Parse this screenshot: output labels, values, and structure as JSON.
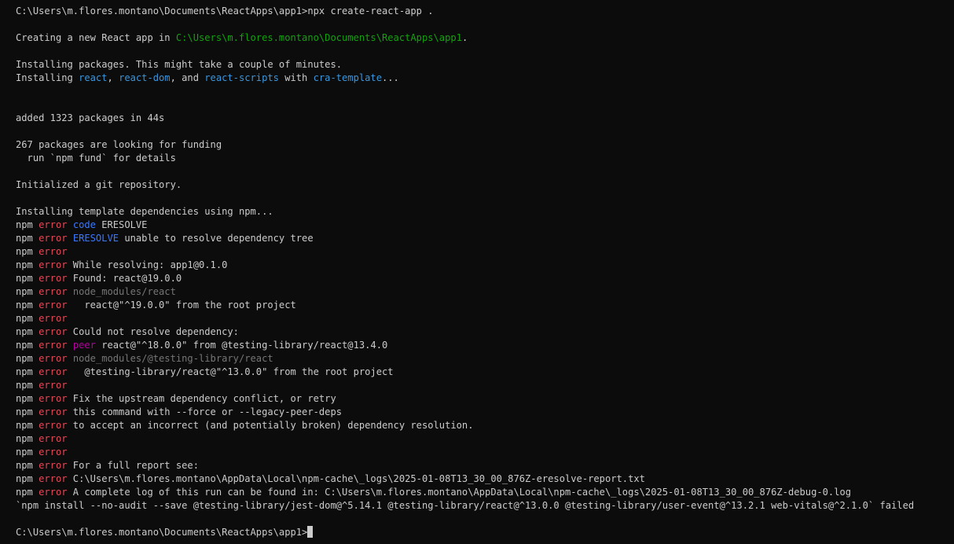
{
  "colors": {
    "background": "#0c0c0c",
    "text": "#cccccc",
    "path_green": "#13a10e",
    "package_cyan": "#3a96dd",
    "error_red": "#e74856",
    "code_blue": "#3b78ff",
    "dim_gray": "#767676",
    "peer_magenta": "#b4009e"
  },
  "lines": [
    [
      {
        "t": "C:\\Users\\m.flores.montano\\Documents\\ReactApps\\app1>npx create-react-app ."
      }
    ],
    [],
    [
      {
        "t": "Creating a new React app in "
      },
      {
        "t": "C:\\Users\\m.flores.montano\\Documents\\ReactApps\\app1",
        "c": "path_green"
      },
      {
        "t": "."
      }
    ],
    [],
    [
      {
        "t": "Installing packages. This might take a couple of minutes."
      }
    ],
    [
      {
        "t": "Installing "
      },
      {
        "t": "react",
        "c": "package_cyan"
      },
      {
        "t": ", "
      },
      {
        "t": "react-dom",
        "c": "package_cyan"
      },
      {
        "t": ", and "
      },
      {
        "t": "react-scripts",
        "c": "package_cyan"
      },
      {
        "t": " with "
      },
      {
        "t": "cra-template",
        "c": "package_cyan"
      },
      {
        "t": "..."
      }
    ],
    [],
    [],
    [
      {
        "t": "added 1323 packages in 44s"
      }
    ],
    [],
    [
      {
        "t": "267 packages are looking for funding"
      }
    ],
    [
      {
        "t": "  run `npm fund` for details"
      }
    ],
    [],
    [
      {
        "t": "Initialized a git repository."
      }
    ],
    [],
    [
      {
        "t": "Installing template dependencies using npm..."
      }
    ],
    [
      {
        "t": "npm "
      },
      {
        "t": "error",
        "c": "error_red"
      },
      {
        "t": " "
      },
      {
        "t": "code",
        "c": "code_blue"
      },
      {
        "t": " ERESOLVE"
      }
    ],
    [
      {
        "t": "npm "
      },
      {
        "t": "error",
        "c": "error_red"
      },
      {
        "t": " "
      },
      {
        "t": "ERESOLVE",
        "c": "code_blue"
      },
      {
        "t": " unable to resolve dependency tree"
      }
    ],
    [
      {
        "t": "npm "
      },
      {
        "t": "error",
        "c": "error_red"
      }
    ],
    [
      {
        "t": "npm "
      },
      {
        "t": "error",
        "c": "error_red"
      },
      {
        "t": " While resolving: app1@0.1.0"
      }
    ],
    [
      {
        "t": "npm "
      },
      {
        "t": "error",
        "c": "error_red"
      },
      {
        "t": " Found: react@19.0.0"
      }
    ],
    [
      {
        "t": "npm "
      },
      {
        "t": "error",
        "c": "error_red"
      },
      {
        "t": " "
      },
      {
        "t": "node_modules/react",
        "c": "dim_gray"
      }
    ],
    [
      {
        "t": "npm "
      },
      {
        "t": "error",
        "c": "error_red"
      },
      {
        "t": "   react@\"^19.0.0\" from the root project"
      }
    ],
    [
      {
        "t": "npm "
      },
      {
        "t": "error",
        "c": "error_red"
      }
    ],
    [
      {
        "t": "npm "
      },
      {
        "t": "error",
        "c": "error_red"
      },
      {
        "t": " Could not resolve dependency:"
      }
    ],
    [
      {
        "t": "npm "
      },
      {
        "t": "error",
        "c": "error_red"
      },
      {
        "t": " "
      },
      {
        "t": "peer",
        "c": "peer_magenta"
      },
      {
        "t": " react@\"^18.0.0\" from @testing-library/react@13.4.0"
      }
    ],
    [
      {
        "t": "npm "
      },
      {
        "t": "error",
        "c": "error_red"
      },
      {
        "t": " "
      },
      {
        "t": "node_modules/@testing-library/react",
        "c": "dim_gray"
      }
    ],
    [
      {
        "t": "npm "
      },
      {
        "t": "error",
        "c": "error_red"
      },
      {
        "t": "   @testing-library/react@\"^13.0.0\" from the root project"
      }
    ],
    [
      {
        "t": "npm "
      },
      {
        "t": "error",
        "c": "error_red"
      }
    ],
    [
      {
        "t": "npm "
      },
      {
        "t": "error",
        "c": "error_red"
      },
      {
        "t": " Fix the upstream dependency conflict, or retry"
      }
    ],
    [
      {
        "t": "npm "
      },
      {
        "t": "error",
        "c": "error_red"
      },
      {
        "t": " this command with --force or --legacy-peer-deps"
      }
    ],
    [
      {
        "t": "npm "
      },
      {
        "t": "error",
        "c": "error_red"
      },
      {
        "t": " to accept an incorrect (and potentially broken) dependency resolution."
      }
    ],
    [
      {
        "t": "npm "
      },
      {
        "t": "error",
        "c": "error_red"
      }
    ],
    [
      {
        "t": "npm "
      },
      {
        "t": "error",
        "c": "error_red"
      }
    ],
    [
      {
        "t": "npm "
      },
      {
        "t": "error",
        "c": "error_red"
      },
      {
        "t": " For a full report see:"
      }
    ],
    [
      {
        "t": "npm "
      },
      {
        "t": "error",
        "c": "error_red"
      },
      {
        "t": " C:\\Users\\m.flores.montano\\AppData\\Local\\npm-cache\\_logs\\2025-01-08T13_30_00_876Z-eresolve-report.txt"
      }
    ],
    [
      {
        "t": "npm "
      },
      {
        "t": "error",
        "c": "error_red"
      },
      {
        "t": " A complete log of this run can be found in: C:\\Users\\m.flores.montano\\AppData\\Local\\npm-cache\\_logs\\2025-01-08T13_30_00_876Z-debug-0.log"
      }
    ],
    [
      {
        "t": "`npm install --no-audit --save @testing-library/jest-dom@^5.14.1 @testing-library/react@^13.0.0 @testing-library/user-event@^13.2.1 web-vitals@^2.1.0` failed"
      }
    ],
    [],
    [
      {
        "t": "C:\\Users\\m.flores.montano\\Documents\\ReactApps\\app1>"
      }
    ]
  ]
}
